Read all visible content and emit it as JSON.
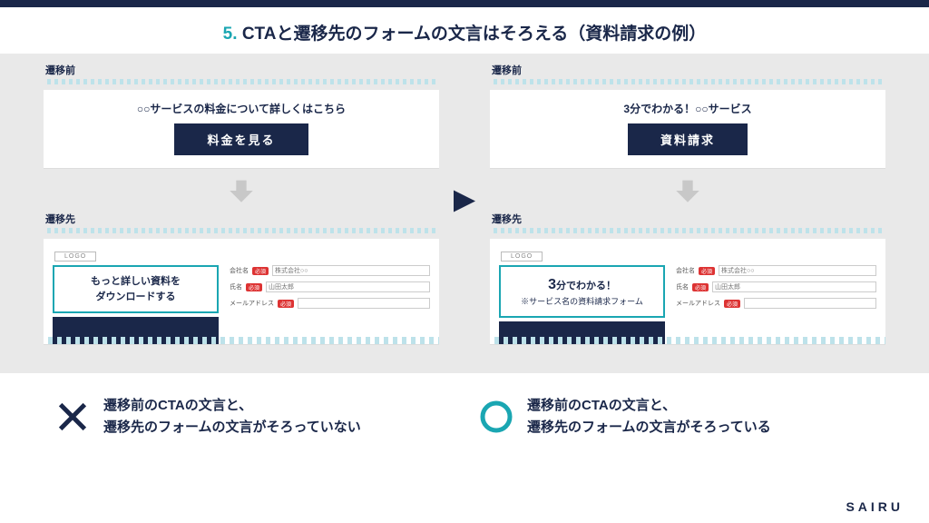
{
  "title": {
    "num": "5.",
    "text": "CTAと遷移先のフォームの文言はそろえる（資料請求の例）"
  },
  "left": {
    "before_label": "遷移前",
    "before_lead": "○○サービスの料金について詳しくはこちら",
    "before_cta": "料金を見る",
    "after_label": "遷移先",
    "logo": "LOGO",
    "callout_l1": "もっと詳しい資料を",
    "callout_l2": "ダウンロードする"
  },
  "right": {
    "before_label": "遷移前",
    "before_lead": "3分でわかる！○○サービス",
    "before_cta": "資料請求",
    "after_label": "遷移先",
    "logo": "LOGO",
    "callout_big": "3",
    "callout_l1": "分でわかる！",
    "callout_l2": "※サービス名の資料請求フォーム"
  },
  "form": {
    "f1": "会社名",
    "f2": "氏名",
    "f3": "メールアドレス",
    "req": "必須",
    "ph_company": "株式会社○○",
    "ph_name": "山田太郎"
  },
  "footer": {
    "bad_l1": "遷移前のCTAの文言と、",
    "bad_l2": "遷移先のフォームの文言がそろっていない",
    "good_l1": "遷移前のCTAの文言と、",
    "good_l2": "遷移先のフォームの文言がそろっている"
  },
  "brand": "SAIRU"
}
